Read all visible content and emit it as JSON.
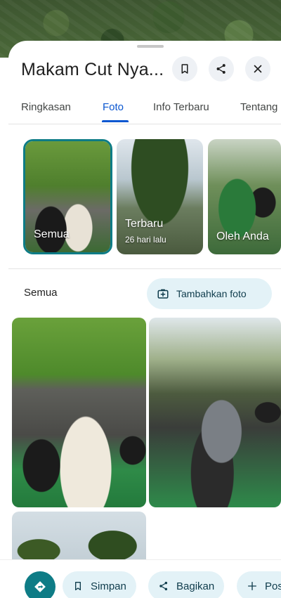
{
  "place": {
    "title": "Makam Cut Nya..."
  },
  "header_icons": [
    "bookmark-icon",
    "share-icon",
    "close-icon"
  ],
  "tabs": [
    {
      "label": "Ringkasan",
      "active": false
    },
    {
      "label": "Foto",
      "active": true
    },
    {
      "label": "Info Terbaru",
      "active": false
    },
    {
      "label": "Tentang",
      "active": false
    }
  ],
  "photo_categories": [
    {
      "label": "Semua",
      "sublabel": "",
      "selected": true
    },
    {
      "label": "Terbaru",
      "sublabel": "26 hari lalu",
      "selected": false
    },
    {
      "label": "Oleh Anda",
      "sublabel": "",
      "selected": false
    }
  ],
  "section": {
    "title": "Semua",
    "add_photo_label": "Tambahkan foto"
  },
  "actions": {
    "directions_icon": "directions-icon",
    "save_label": "Simpan",
    "share_label": "Bagikan",
    "post_label": "Pos"
  },
  "colors": {
    "accent_teal": "#0e7c86",
    "active_tab_blue": "#0b57d0",
    "pill_bg": "#e3f2f7"
  }
}
